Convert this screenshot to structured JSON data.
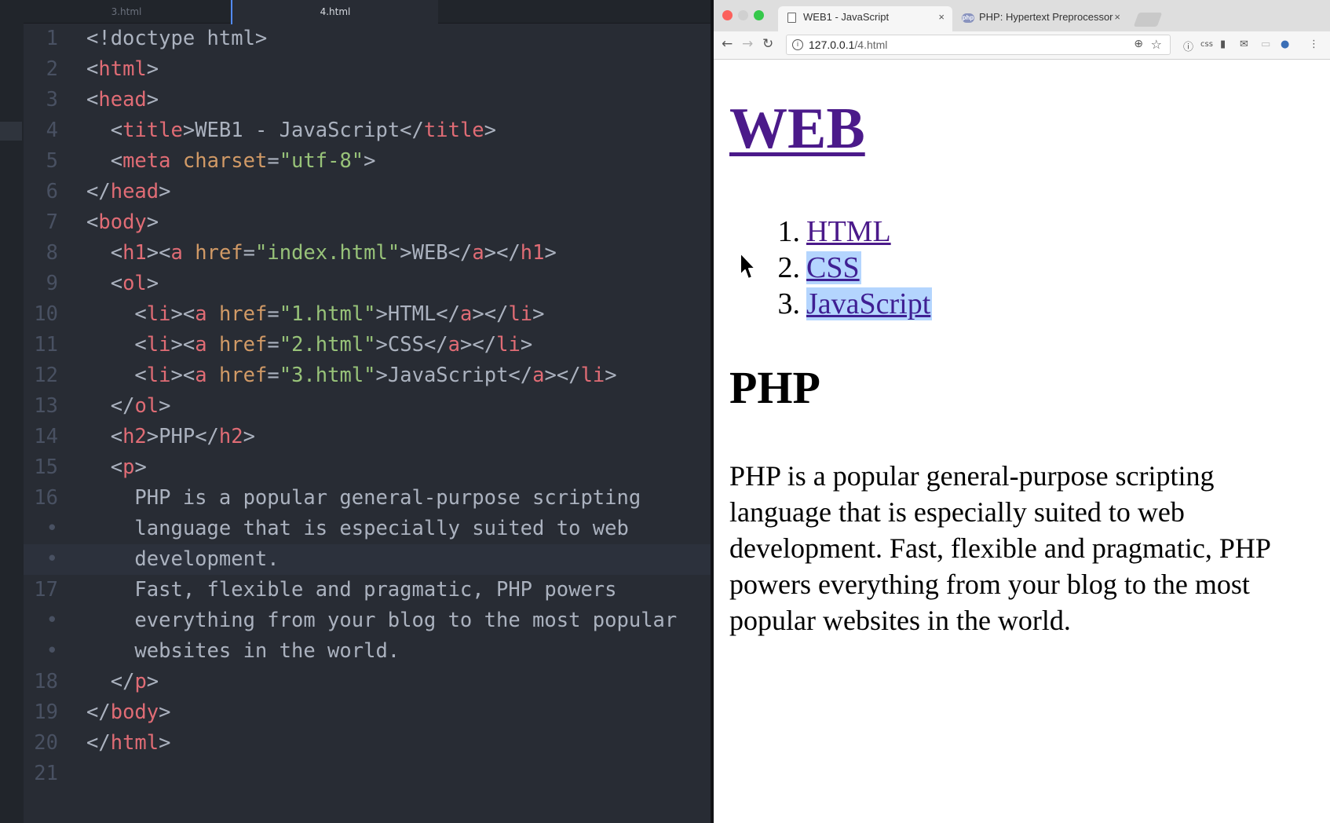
{
  "editor": {
    "tabs": [
      {
        "label": "3.html",
        "active": false
      },
      {
        "label": "4.html",
        "active": true
      }
    ]
  },
  "browser": {
    "tabs": [
      {
        "title": "WEB1 - JavaScript",
        "icon": "page-icon",
        "close": "×"
      },
      {
        "title": "PHP: Hypertext Preprocessor",
        "icon": "php-favicon",
        "close": "×"
      }
    ],
    "php_favicon_text": "php",
    "url_host": "127.0.0.1",
    "url_path": "/4.html",
    "ext_css_label": "css",
    "page": {
      "h1": "WEB",
      "list": [
        {
          "num": "1.",
          "label": "HTML"
        },
        {
          "num": "2.",
          "label": "CSS"
        },
        {
          "num": "3.",
          "label": "JavaScript"
        }
      ],
      "h2": "PHP",
      "paragraph": "PHP is a popular general-purpose scripting language that is especially suited to web development. Fast, flexible and pragmatic, PHP powers everything from your blog to the most popular websites in the world."
    }
  },
  "code_lines": [
    {
      "num": "1",
      "html": "<span class='p'>&lt;!doctype html&gt;</span>"
    },
    {
      "num": "2",
      "html": "<span class='p'>&lt;</span><span class='t'>html</span><span class='p'>&gt;</span>"
    },
    {
      "num": "3",
      "html": "<span class='p'>&lt;</span><span class='t'>head</span><span class='p'>&gt;</span>"
    },
    {
      "num": "4",
      "html": "  <span class='p'>&lt;</span><span class='t'>title</span><span class='p'>&gt;WEB1 - JavaScript&lt;/</span><span class='t'>title</span><span class='p'>&gt;</span>"
    },
    {
      "num": "5",
      "html": "  <span class='p'>&lt;</span><span class='t'>meta</span> <span class='a'>charset</span><span class='p'>=</span><span class='s'>\"utf-8\"</span><span class='p'>&gt;</span>"
    },
    {
      "num": "6",
      "html": "<span class='p'>&lt;/</span><span class='t'>head</span><span class='p'>&gt;</span>"
    },
    {
      "num": "7",
      "html": "<span class='p'>&lt;</span><span class='t'>body</span><span class='p'>&gt;</span>"
    },
    {
      "num": "8",
      "html": "  <span class='p'>&lt;</span><span class='t'>h1</span><span class='p'>&gt;&lt;</span><span class='t'>a</span> <span class='a'>href</span><span class='p'>=</span><span class='s'>\"index.html\"</span><span class='p'>&gt;WEB&lt;/</span><span class='t'>a</span><span class='p'>&gt;&lt;/</span><span class='t'>h1</span><span class='p'>&gt;</span>"
    },
    {
      "num": "9",
      "html": "  <span class='p'>&lt;</span><span class='t'>ol</span><span class='p'>&gt;</span>"
    },
    {
      "num": "10",
      "html": "    <span class='p'>&lt;</span><span class='t'>li</span><span class='p'>&gt;&lt;</span><span class='t'>a</span> <span class='a'>href</span><span class='p'>=</span><span class='s'>\"1.html\"</span><span class='p'>&gt;HTML&lt;/</span><span class='t'>a</span><span class='p'>&gt;&lt;/</span><span class='t'>li</span><span class='p'>&gt;</span>"
    },
    {
      "num": "11",
      "html": "    <span class='p'>&lt;</span><span class='t'>li</span><span class='p'>&gt;&lt;</span><span class='t'>a</span> <span class='a'>href</span><span class='p'>=</span><span class='s'>\"2.html\"</span><span class='p'>&gt;CSS&lt;/</span><span class='t'>a</span><span class='p'>&gt;&lt;/</span><span class='t'>li</span><span class='p'>&gt;</span>"
    },
    {
      "num": "12",
      "html": "    <span class='p'>&lt;</span><span class='t'>li</span><span class='p'>&gt;&lt;</span><span class='t'>a</span> <span class='a'>href</span><span class='p'>=</span><span class='s'>\"3.html\"</span><span class='p'>&gt;JavaScript&lt;/</span><span class='t'>a</span><span class='p'>&gt;&lt;/</span><span class='t'>li</span><span class='p'>&gt;</span>"
    },
    {
      "num": "13",
      "html": "  <span class='p'>&lt;/</span><span class='t'>ol</span><span class='p'>&gt;</span>"
    },
    {
      "num": "14",
      "html": "  <span class='p'>&lt;</span><span class='t'>h2</span><span class='p'>&gt;PHP&lt;/</span><span class='t'>h2</span><span class='p'>&gt;</span>"
    },
    {
      "num": "15",
      "html": "  <span class='p'>&lt;</span><span class='t'>p</span><span class='p'>&gt;</span>"
    },
    {
      "num": "16",
      "html": "    PHP is a popular general-purpose scripting"
    },
    {
      "num": "•",
      "html": "    language that is especially suited to web"
    },
    {
      "num": "•",
      "html": "    development.",
      "cursor": true
    },
    {
      "num": "17",
      "html": "    Fast, flexible and pragmatic, PHP powers"
    },
    {
      "num": "•",
      "html": "    everything from your blog to the most popular"
    },
    {
      "num": "•",
      "html": "    websites in the world."
    },
    {
      "num": "18",
      "html": "  <span class='p'>&lt;/</span><span class='t'>p</span><span class='p'>&gt;</span>"
    },
    {
      "num": "19",
      "html": "<span class='p'>&lt;/</span><span class='t'>body</span><span class='p'>&gt;</span>"
    },
    {
      "num": "20",
      "html": "<span class='p'>&lt;/</span><span class='t'>html</span><span class='p'>&gt;</span>"
    },
    {
      "num": "21",
      "html": ""
    }
  ],
  "colors": {
    "tag": "#e06c75",
    "attr": "#d19a66",
    "string": "#98c379",
    "link": "#4b1a8a",
    "selection": "#b4d5fe"
  }
}
